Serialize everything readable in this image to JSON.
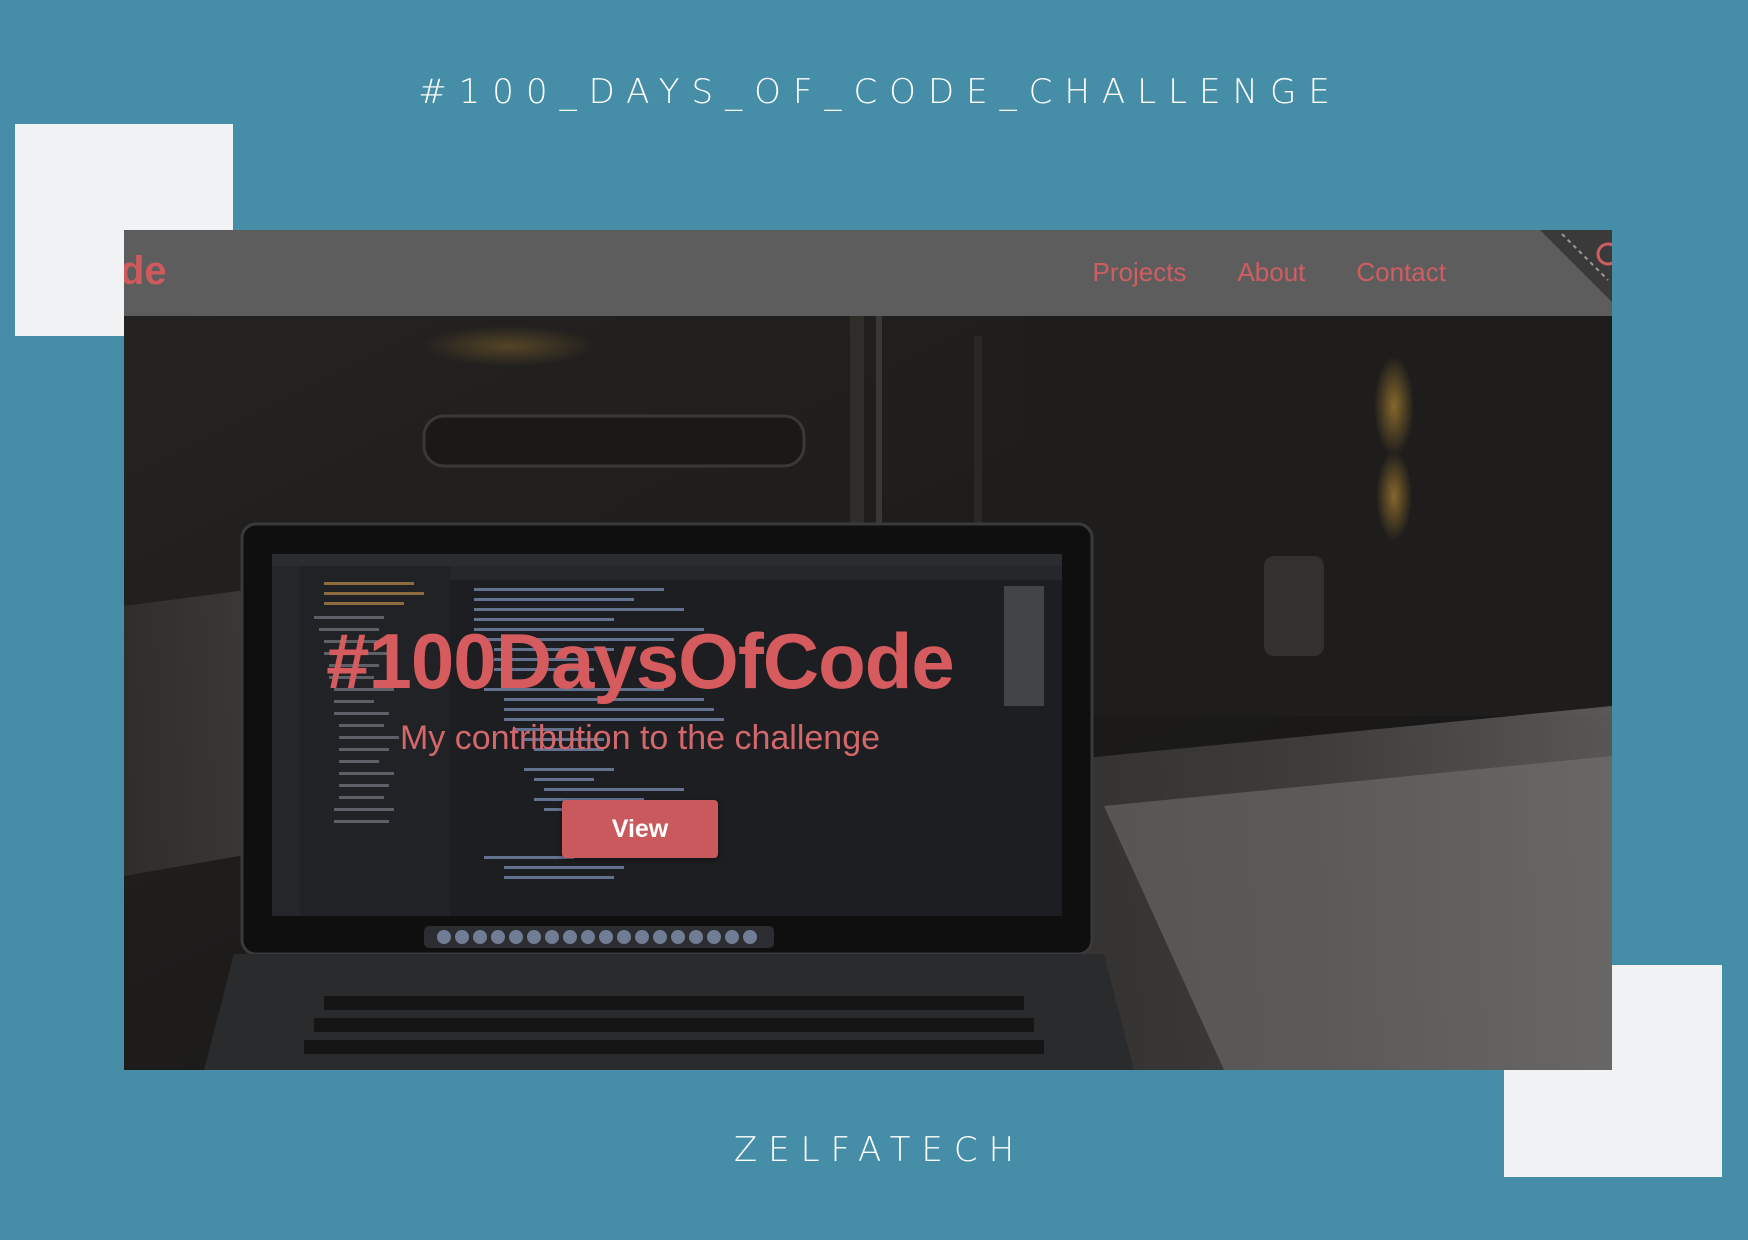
{
  "header": {
    "title": "#100_DAYS_OF_CODE_CHALLENGE"
  },
  "footer": {
    "brand": "ZELFATECH"
  },
  "site": {
    "logo_text": "de",
    "nav": {
      "projects": "Projects",
      "about": "About",
      "contact": "Contact"
    },
    "hero": {
      "title": "#100DaysOfCode",
      "subtitle": "My contribution to the challenge",
      "button_label": "View"
    }
  },
  "colors": {
    "background": "#468ea8",
    "panel": "#f1f2f4",
    "navbar": "#5e5d5e",
    "accent": "#d65b5e"
  }
}
